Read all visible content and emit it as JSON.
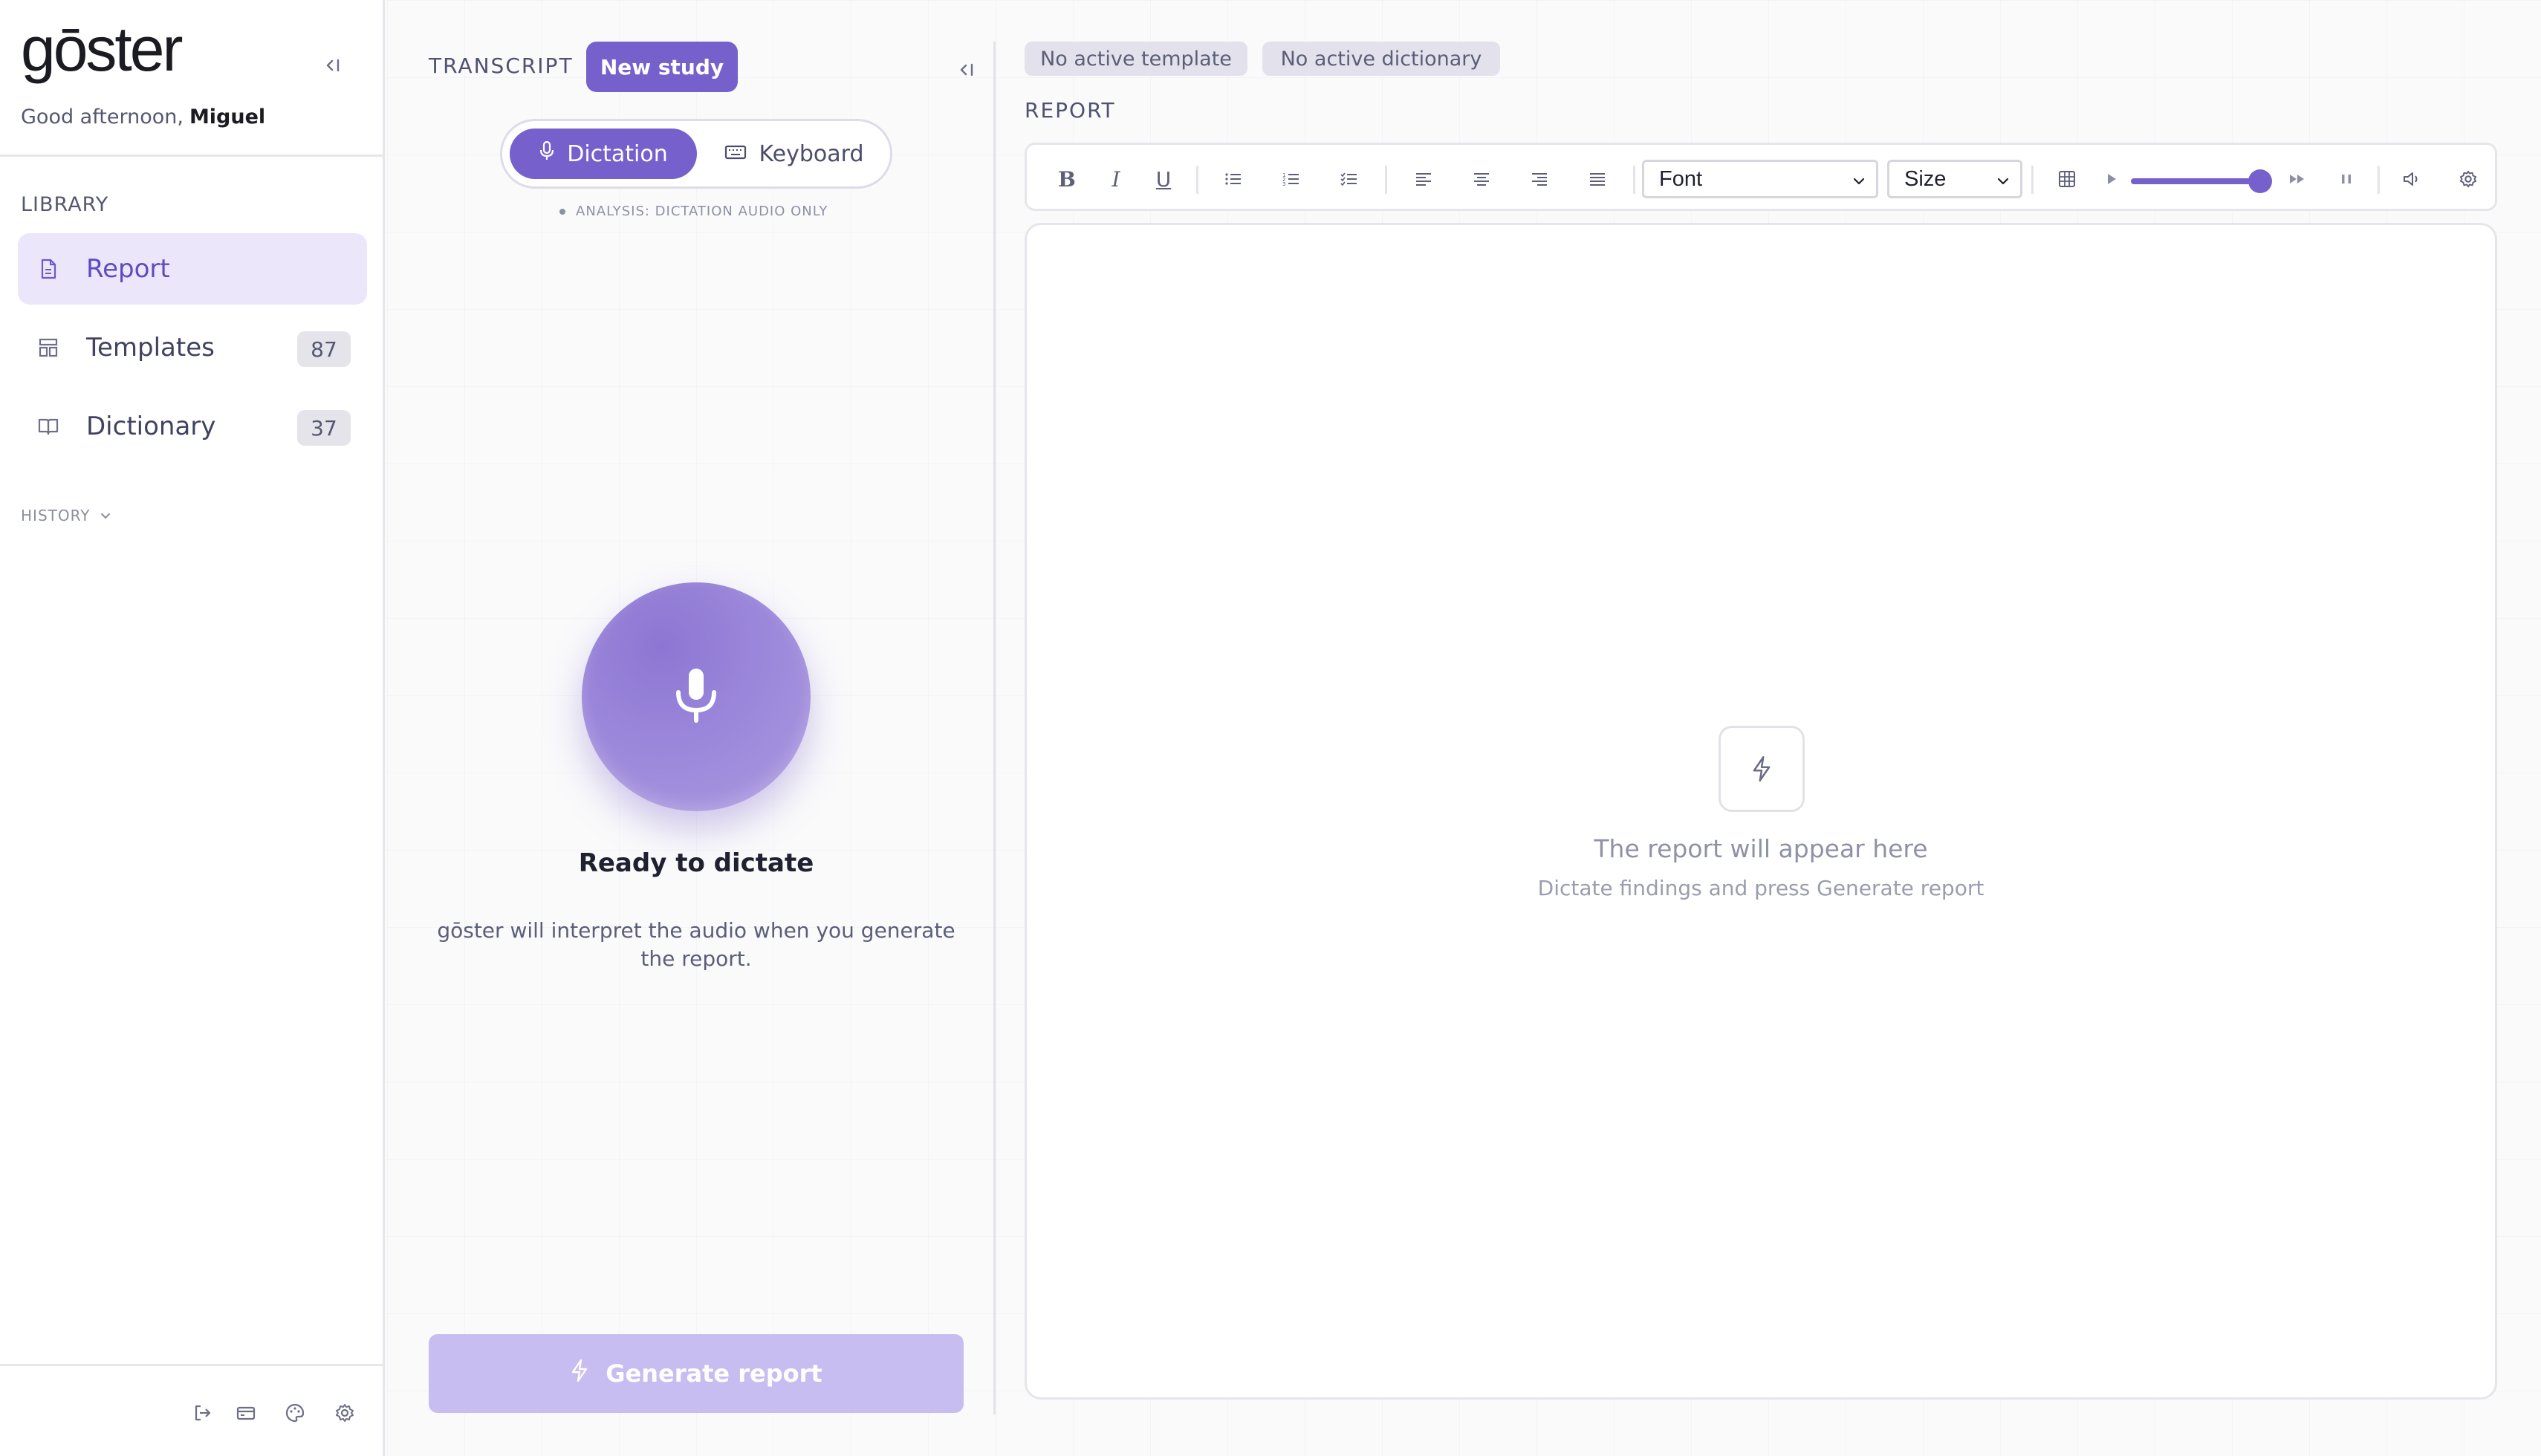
{
  "sidebar": {
    "logo": "gōster",
    "greeting_prefix": "Good afternoon,",
    "user_name": "Miguel",
    "library_heading": "LIBRARY",
    "items": [
      {
        "label": "Report",
        "icon": "document-icon",
        "active": true
      },
      {
        "label": "Templates",
        "icon": "templates-icon",
        "count": "87"
      },
      {
        "label": "Dictionary",
        "icon": "book-icon",
        "count": "37"
      }
    ],
    "history_label": "HISTORY",
    "footer_icons": [
      "logout-icon",
      "card-icon",
      "palette-icon",
      "settings-icon"
    ]
  },
  "transcript": {
    "heading": "TRANSCRIPT",
    "new_study_label": "New study",
    "modes": [
      {
        "label": "Dictation",
        "icon": "mic-icon",
        "active": true
      },
      {
        "label": "Keyboard",
        "icon": "keyboard-icon",
        "active": false
      }
    ],
    "analysis_note": "ANALYSIS: DICTATION AUDIO ONLY",
    "ready_text": "Ready to dictate",
    "interpret_text": "gōster will interpret the audio when you generate the report.",
    "generate_label": "Generate report"
  },
  "report": {
    "chips": [
      "No active template",
      "No active dictionary"
    ],
    "heading": "REPORT",
    "toolbar": {
      "bold": "B",
      "italic": "I",
      "underline": "U",
      "font_select": "Font",
      "size_select": "Size"
    },
    "playback_level": 1.0,
    "empty_title": "The report will appear here",
    "empty_subtitle": "Dictate findings and press Generate report"
  },
  "colors": {
    "accent": "#7560cc",
    "accent_soft": "#ebe6fa",
    "generate_disabled": "#c8bdf0",
    "chip_bg": "#e3e1ec"
  }
}
